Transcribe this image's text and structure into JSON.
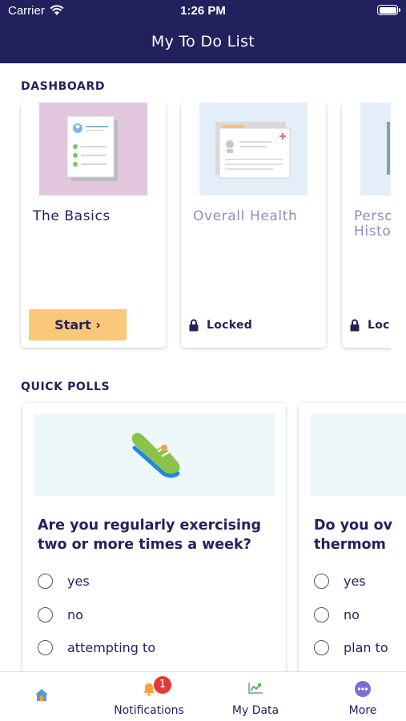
{
  "status_bar": {
    "carrier": "Carrier",
    "time": "1:26 PM"
  },
  "header": {
    "title": "My To Do List"
  },
  "dashboard": {
    "heading": "DASHBOARD",
    "cards": [
      {
        "title": "The Basics",
        "action_label": "Start",
        "action_chevron": "›"
      },
      {
        "title": "Overall Health",
        "status": "Locked"
      },
      {
        "title_line1": "Perso",
        "title_line2": "Histo",
        "status": "Loc"
      }
    ]
  },
  "quick_polls": {
    "heading": "QUICK POLLS",
    "polls": [
      {
        "question": "Are you regularly exercising two or more times a week?",
        "options": [
          "yes",
          "no",
          "attempting to"
        ]
      },
      {
        "question_line1": "Do you ov",
        "question_line2": "thermom",
        "options": [
          "yes",
          "no",
          "plan to"
        ]
      }
    ]
  },
  "tab_bar": {
    "tabs": [
      {
        "label": "",
        "icon": "home-icon"
      },
      {
        "label": "Notifications",
        "icon": "bell-icon",
        "badge": "1"
      },
      {
        "label": "My Data",
        "icon": "chart-icon"
      },
      {
        "label": "More",
        "icon": "more-icon"
      }
    ]
  },
  "colors": {
    "navy": "#21215e",
    "start_button": "#f9c879",
    "badge": "#e53935",
    "muted_title": "#8e8fb8"
  }
}
